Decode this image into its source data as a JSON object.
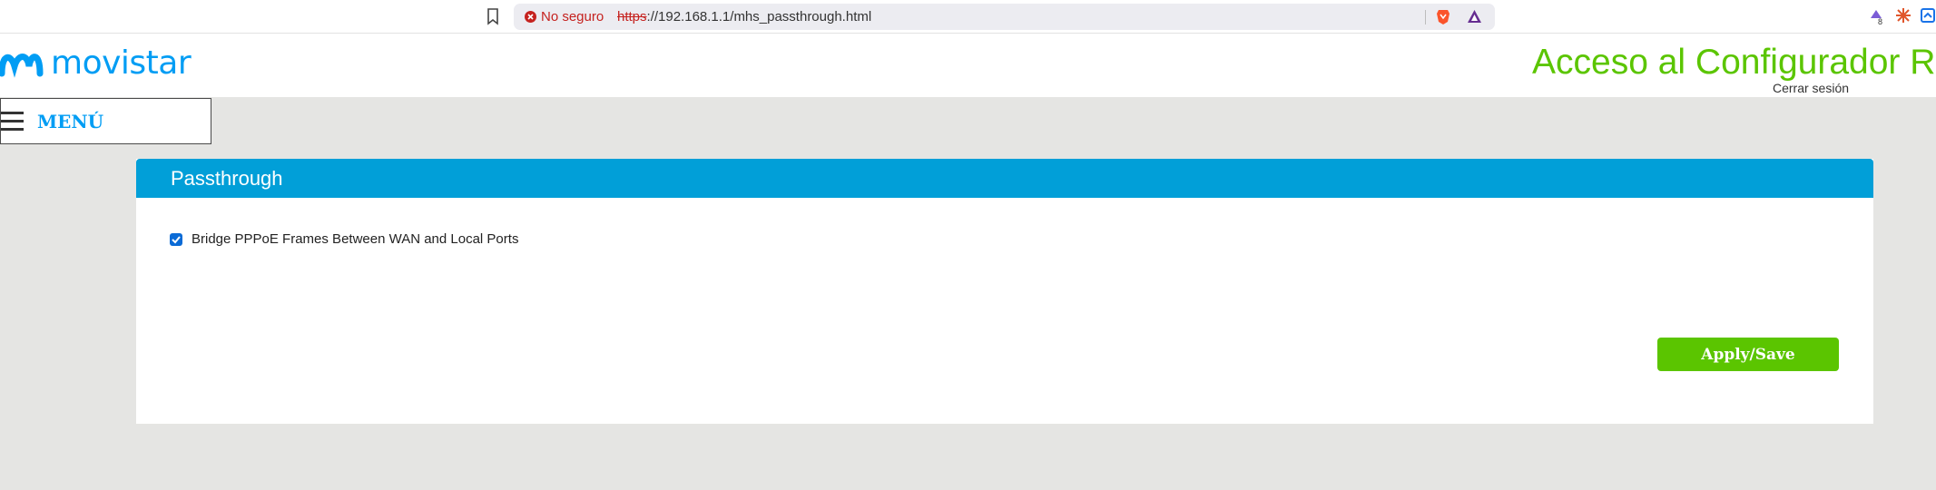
{
  "browser": {
    "security_label": "No seguro",
    "url_scheme": "https",
    "url_rest": "://192.168.1.1/mhs_passthrough.html",
    "extension_badge": "8"
  },
  "header": {
    "logo_text": "movistar",
    "title": "Acceso al Configurador Router",
    "logout_label": "Cerrar sesión"
  },
  "menu": {
    "label": "MENÚ"
  },
  "panel": {
    "title": "Passthrough",
    "option": {
      "label": "Bridge PPPoE Frames Between WAN and Local Ports",
      "checked": true
    },
    "apply_label": "Apply/Save"
  },
  "colors": {
    "brand_blue": "#019df4",
    "header_bar": "#019fd8",
    "accent_green": "#5bc500",
    "background": "#e5e5e3"
  }
}
